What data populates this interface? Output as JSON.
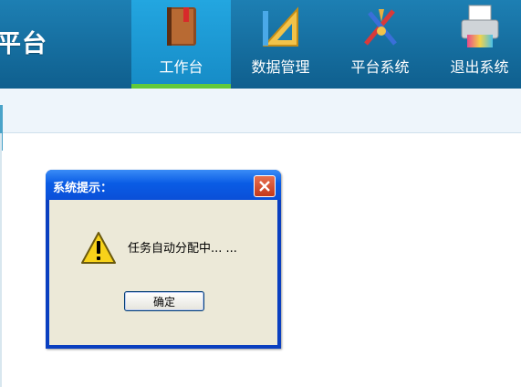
{
  "header": {
    "brand": "平台",
    "nav": [
      {
        "label": "工作台",
        "icon": "book-icon",
        "active": true
      },
      {
        "label": "数据管理",
        "icon": "ruler-triangle-icon",
        "active": false
      },
      {
        "label": "平台系统",
        "icon": "tools-icon",
        "active": false
      },
      {
        "label": "退出系统",
        "icon": "printer-icon",
        "active": false
      }
    ]
  },
  "dialog": {
    "title": "系统提示：",
    "message": "任务自动分配中... ...",
    "ok_label": "确定",
    "icon": "warning-icon"
  },
  "colors": {
    "header_bg": "#0f5f8e",
    "active_tab": "#1f9cd8",
    "active_underline": "#62c93a",
    "dialog_frame": "#0a3fc0"
  }
}
